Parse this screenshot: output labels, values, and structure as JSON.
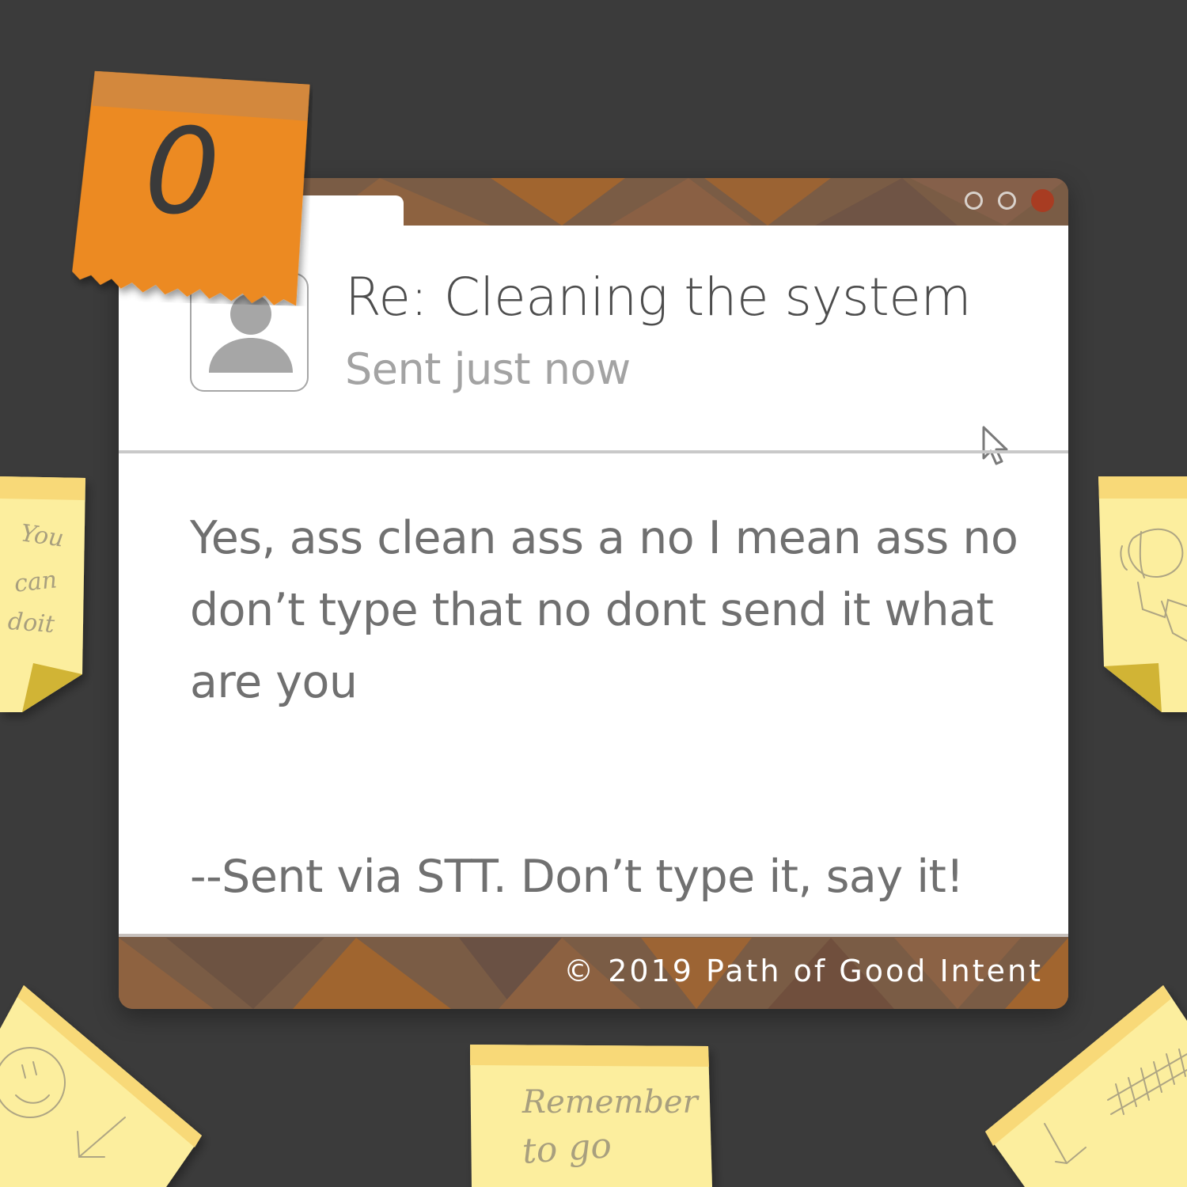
{
  "counter_note": {
    "value": "0"
  },
  "window": {
    "controls": [
      "minimize",
      "maximize",
      "close"
    ],
    "colors": {
      "frame": "#7a5c45",
      "accent": "#e8891f",
      "close": "#a83c22"
    }
  },
  "email": {
    "subject": "Re: Cleaning the system",
    "status": "Sent just now",
    "body": "Yes, ass clean ass a no I mean ass no don’t type that no dont send it what are you",
    "signature": "--Sent via STT. Don’t type it, say it!"
  },
  "footer": {
    "copyright": "© 2019 Path of Good Intent"
  },
  "sticky_notes": {
    "left": {
      "line1": "You",
      "line2": "can",
      "line3": "doit"
    },
    "bottom": {
      "line1": "Remember",
      "line2": "to go"
    }
  }
}
